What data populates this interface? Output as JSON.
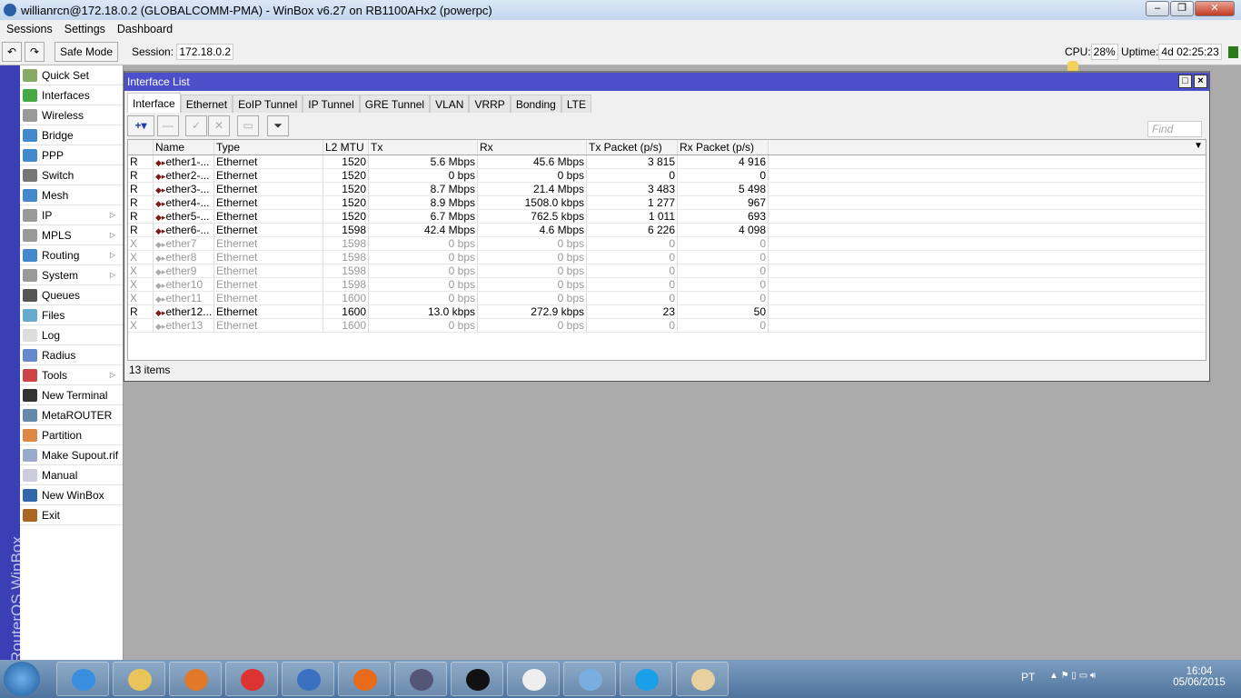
{
  "window_title": "willianrcn@172.18.0.2 (GLOBALCOMM-PMA) - WinBox v6.27 on RB1100AHx2 (powerpc)",
  "menu": [
    "Sessions",
    "Settings",
    "Dashboard"
  ],
  "toolbar": {
    "safe_mode": "Safe Mode",
    "session_label": "Session:",
    "session": "172.18.0.2",
    "cpu_label": "CPU:",
    "cpu": "28%",
    "uptime_label": "Uptime:",
    "uptime": "4d 02:25:23"
  },
  "brand": "RouterOS WinBox",
  "sidebar": [
    {
      "label": "Quick Set",
      "icon": "wand",
      "c": "#8a6"
    },
    {
      "label": "Interfaces",
      "icon": "interfaces",
      "c": "#4a4"
    },
    {
      "label": "Wireless",
      "icon": "wireless",
      "c": "#999"
    },
    {
      "label": "Bridge",
      "icon": "bridge",
      "c": "#48c"
    },
    {
      "label": "PPP",
      "icon": "ppp",
      "c": "#48c"
    },
    {
      "label": "Switch",
      "icon": "switch",
      "c": "#777"
    },
    {
      "label": "Mesh",
      "icon": "mesh",
      "c": "#48c"
    },
    {
      "label": "IP",
      "icon": "ip",
      "c": "#999",
      "sub": true
    },
    {
      "label": "MPLS",
      "icon": "mpls",
      "c": "#999",
      "sub": true
    },
    {
      "label": "Routing",
      "icon": "routing",
      "c": "#48c",
      "sub": true
    },
    {
      "label": "System",
      "icon": "gear",
      "c": "#999",
      "sub": true
    },
    {
      "label": "Queues",
      "icon": "queues",
      "c": "#555"
    },
    {
      "label": "Files",
      "icon": "folder",
      "c": "#6ac"
    },
    {
      "label": "Log",
      "icon": "log",
      "c": "#ddd"
    },
    {
      "label": "Radius",
      "icon": "radius",
      "c": "#68c"
    },
    {
      "label": "Tools",
      "icon": "tools",
      "c": "#c44",
      "sub": true
    },
    {
      "label": "New Terminal",
      "icon": "terminal",
      "c": "#333"
    },
    {
      "label": "MetaROUTER",
      "icon": "metarouter",
      "c": "#68a"
    },
    {
      "label": "Partition",
      "icon": "partition",
      "c": "#d84"
    },
    {
      "label": "Make Supout.rif",
      "icon": "supout",
      "c": "#9ac"
    },
    {
      "label": "Manual",
      "icon": "manual",
      "c": "#ccd"
    },
    {
      "label": "New WinBox",
      "icon": "winbox",
      "c": "#36a"
    },
    {
      "label": "Exit",
      "icon": "exit",
      "c": "#a62"
    }
  ],
  "interface_window": {
    "title": "Interface List",
    "tabs": [
      "Interface",
      "Ethernet",
      "EoIP Tunnel",
      "IP Tunnel",
      "GRE Tunnel",
      "VLAN",
      "VRRP",
      "Bonding",
      "LTE"
    ],
    "find_placeholder": "Find",
    "status": "13 items",
    "columns": [
      "",
      "Name",
      "Type",
      "L2 MTU",
      "Tx",
      "Rx",
      "Tx Packet (p/s)",
      "Rx Packet (p/s)"
    ],
    "rows": [
      [
        "R",
        "ether1-...",
        "Ethernet",
        "1520",
        "5.6 Mbps",
        "45.6 Mbps",
        "3 815",
        "4 916"
      ],
      [
        "R",
        "ether2-...",
        "Ethernet",
        "1520",
        "0 bps",
        "0 bps",
        "0",
        "0"
      ],
      [
        "R",
        "ether3-...",
        "Ethernet",
        "1520",
        "8.7 Mbps",
        "21.4 Mbps",
        "3 483",
        "5 498"
      ],
      [
        "R",
        "ether4-...",
        "Ethernet",
        "1520",
        "8.9 Mbps",
        "1508.0 kbps",
        "1 277",
        "967"
      ],
      [
        "R",
        "ether5-...",
        "Ethernet",
        "1520",
        "6.7 Mbps",
        "762.5 kbps",
        "1 011",
        "693"
      ],
      [
        "R",
        "ether6-...",
        "Ethernet",
        "1598",
        "42.4 Mbps",
        "4.6 Mbps",
        "6 226",
        "4 098"
      ],
      [
        "X",
        "ether7",
        "Ethernet",
        "1598",
        "0 bps",
        "0 bps",
        "0",
        "0"
      ],
      [
        "X",
        "ether8",
        "Ethernet",
        "1598",
        "0 bps",
        "0 bps",
        "0",
        "0"
      ],
      [
        "X",
        "ether9",
        "Ethernet",
        "1598",
        "0 bps",
        "0 bps",
        "0",
        "0"
      ],
      [
        "X",
        "ether10",
        "Ethernet",
        "1598",
        "0 bps",
        "0 bps",
        "0",
        "0"
      ],
      [
        "X",
        "ether11",
        "Ethernet",
        "1600",
        "0 bps",
        "0 bps",
        "0",
        "0"
      ],
      [
        "R",
        "ether12...",
        "Ethernet",
        "1600",
        "13.0 kbps",
        "272.9 kbps",
        "23",
        "50"
      ],
      [
        "X",
        "ether13",
        "Ethernet",
        "1600",
        "0 bps",
        "0 bps",
        "0",
        "0"
      ]
    ]
  },
  "taskbar": {
    "apps": [
      "internet-explorer",
      "file-explorer",
      "media-player",
      "chrome",
      "winbox",
      "firefox",
      "vpn",
      "command-prompt",
      "chart-app",
      "control-panel",
      "skype",
      "paint"
    ],
    "lang": "PT",
    "time": "16:04",
    "date": "05/06/2015"
  }
}
